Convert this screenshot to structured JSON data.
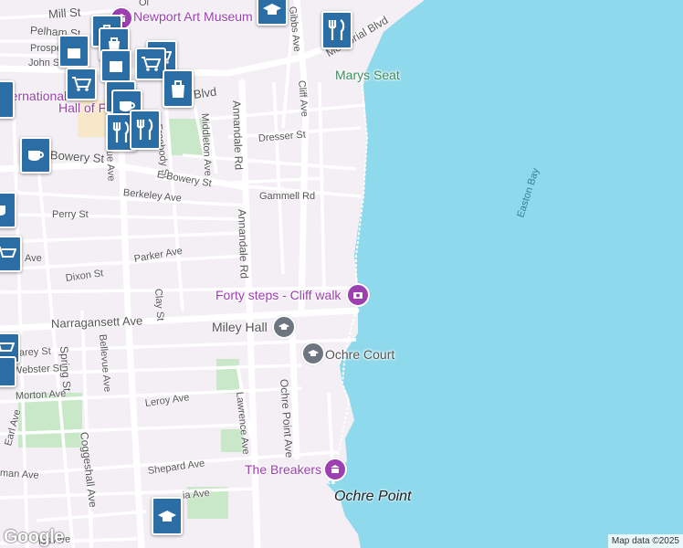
{
  "map": {
    "water_name": "Easton Bay",
    "place_label": "Ochre Point",
    "attribution": "Map data ©2025",
    "logo": "Google",
    "colors": {
      "water": "#8fd9ec",
      "land": "#f3eff5",
      "park": "#c8e8c8",
      "road_major": "#ffffff",
      "poi_purple": "#9c3fb0",
      "poi_gray": "#6c7580",
      "pin": "#2a6ea5"
    }
  },
  "pois": {
    "art_museum": "Newport Art Museum",
    "marys_seat": "Marys Seat",
    "forty_steps": "Forty steps - Cliff walk",
    "miley_hall": "Miley Hall",
    "ochre_court": "Ochre Court",
    "breakers": "The Breakers",
    "hall_fame_1": "nternational",
    "hall_fame_2": "Hall of Fame"
  },
  "streets": {
    "mill": "Mill St",
    "pelham": "Pelham St",
    "prospect": "Prospe",
    "john": "John St",
    "gibbs": "Gibbs Ave",
    "memorial": "Memorial Blvd",
    "memorial_left": "Blvd",
    "cliff": "Cliff Ave",
    "annandale": "Annandale Rd",
    "middleton": "Middleton Ave",
    "freebody": "Freebody St",
    "dresser": "Dresser St",
    "bowery": "Bowery St",
    "e_bowery": "E Bowery St",
    "gammell": "Gammell Rd",
    "berkeley": "Berkeley Ave",
    "perry": "Perry St",
    "parker": "Parker Ave",
    "dixon": "Dixon St",
    "clay": "Clay St",
    "narragansett": "Narragansett Ave",
    "bellevue": "Bellevue Ave",
    "bellevue_top": "ue Ave",
    "spring": "Spring St",
    "carey": "Carey St",
    "webster": "Webster St",
    "morton": "Morton Ave",
    "leroy": "Leroy Ave",
    "lawrence": "Lawrence Ave",
    "ochre_point": "Ochre Point Ave",
    "earl": "Earl Ave",
    "coggeshall": "Coggeshall Ave",
    "shepard": "Shepard Ave",
    "man": "man Ave",
    "ia": "ia Ave",
    "les": "les Ave",
    "ave_left": "Ave",
    "olc": "Ol"
  }
}
